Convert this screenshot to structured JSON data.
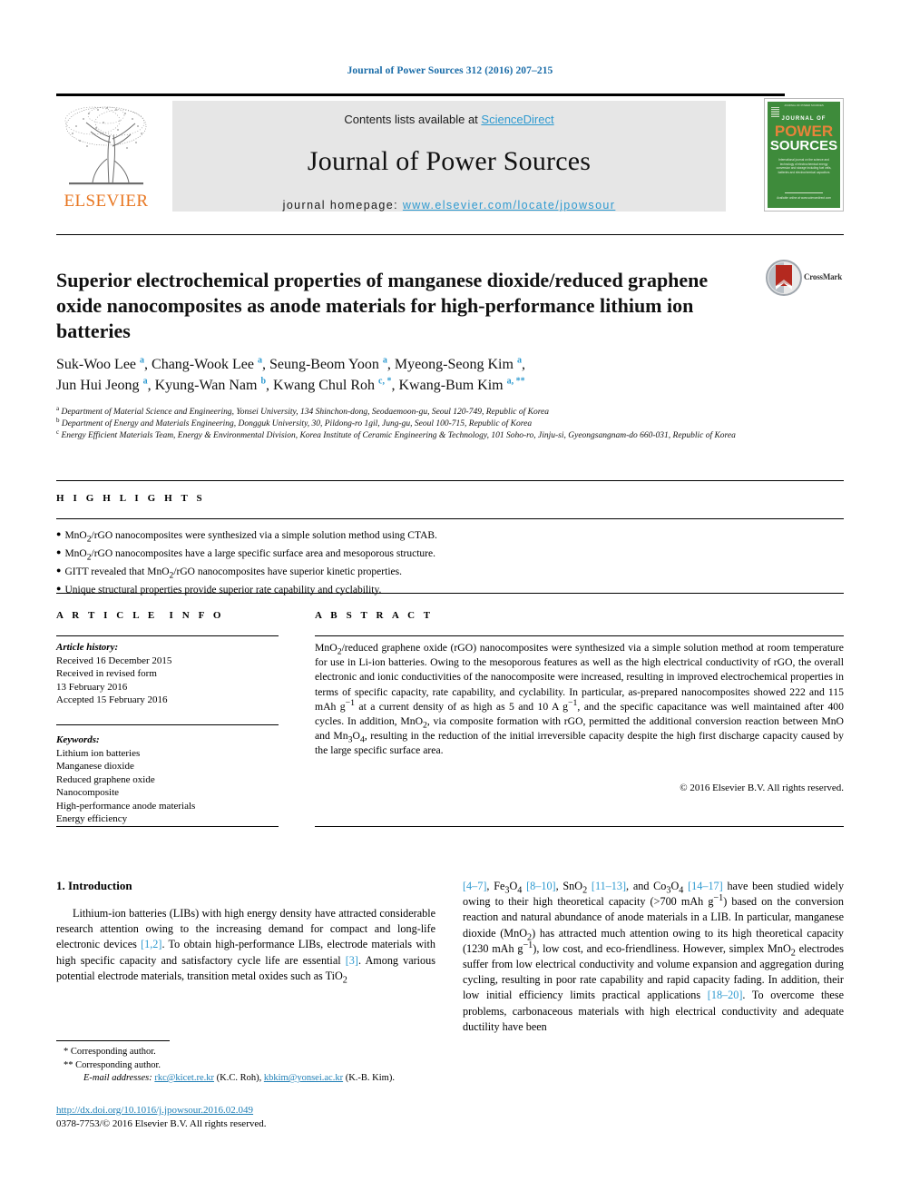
{
  "running_head": "Journal of Power Sources 312 (2016) 207–215",
  "masthead": {
    "contents_prefix": "Contents lists available at ",
    "sciencedirect": "ScienceDirect",
    "journal_name": "Journal of Power Sources",
    "homepage_label": "journal homepage:",
    "homepage_url": "www.elsevier.com/locate/jpowsour",
    "publisher": "ELSEVIER",
    "publisher_logo_icon": "elsevier-tree-icon"
  },
  "cover": {
    "top_bar": "JOURNAL OF POWER SOURCES",
    "journal_of": "JOURNAL OF",
    "power": "POWER",
    "sources": "SOURCES",
    "blurb": "International journal on the science and technology of electrochemical energy conversion and storage including fuel cells, batteries and electrochemical capacitors",
    "bottom": "Available online at www.sciencedirect.com"
  },
  "crossmark": {
    "label": "CrossMark",
    "icon": "crossmark-icon"
  },
  "title": "Superior electrochemical properties of manganese dioxide/reduced graphene oxide nanocomposites as anode materials for high-performance lithium ion batteries",
  "authors": [
    {
      "name": "Suk-Woo Lee",
      "marks": "a",
      "sep": ", "
    },
    {
      "name": "Chang-Wook Lee",
      "marks": "a",
      "sep": ", "
    },
    {
      "name": "Seung-Beom Yoon",
      "marks": "a",
      "sep": ", "
    },
    {
      "name": "Myeong-Seong Kim",
      "marks": "a",
      "sep": ", "
    },
    {
      "name": "Jun Hui Jeong",
      "marks": "a",
      "sep": ", "
    },
    {
      "name": "Kyung-Wan Nam",
      "marks": "b",
      "sep": ", "
    },
    {
      "name": "Kwang Chul Roh",
      "marks": "c, *",
      "sep": ", "
    },
    {
      "name": "Kwang-Bum Kim",
      "marks": "a, **",
      "sep": ""
    }
  ],
  "affiliations": [
    {
      "mark": "a",
      "text": "Department of Material Science and Engineering, Yonsei University, 134 Shinchon-dong, Seodaemoon-gu, Seoul 120-749, Republic of Korea"
    },
    {
      "mark": "b",
      "text": "Department of Energy and Materials Engineering, Dongguk University, 30, Pildong-ro 1gil, Jung-gu, Seoul 100-715, Republic of Korea"
    },
    {
      "mark": "c",
      "text": "Energy Efficient Materials Team, Energy & Environmental Division, Korea Institute of Ceramic Engineering & Technology, 101 Soho-ro, Jinju-si, Gyeongsangnam-do 660-031, Republic of Korea"
    }
  ],
  "highlights": {
    "heading": "HIGHLIGHTS",
    "items": [
      "MnO2/rGO nanocomposites were synthesized via a simple solution method using CTAB.",
      "MnO2/rGO nanocomposites have a large specific surface area and mesoporous structure.",
      "GITT revealed that MnO2/rGO nanocomposites have superior kinetic properties.",
      "Unique structural properties provide superior rate capability and cyclability."
    ]
  },
  "article_info": {
    "heading": "ARTICLE INFO",
    "history_label": "Article history:",
    "history": [
      "Received 16 December 2015",
      "Received in revised form",
      "13 February 2016",
      "Accepted 15 February 2016"
    ],
    "keywords_label": "Keywords:",
    "keywords": [
      "Lithium ion batteries",
      "Manganese dioxide",
      "Reduced graphene oxide",
      "Nanocomposite",
      "High-performance anode materials",
      "Energy efficiency"
    ]
  },
  "abstract": {
    "heading": "ABSTRACT",
    "text": "MnO2/reduced graphene oxide (rGO) nanocomposites were synthesized via a simple solution method at room temperature for use in Li-ion batteries. Owing to the mesoporous features as well as the high electrical conductivity of rGO, the overall electronic and ionic conductivities of the nanocomposite were increased, resulting in improved electrochemical properties in terms of specific capacity, rate capability, and cyclability. In particular, as-prepared nanocomposites showed 222 and 115 mAh g−1 at a current density of as high as 5 and 10 A g−1, and the specific capacitance was well maintained after 400 cycles. In addition, MnO2, via composite formation with rGO, permitted the additional conversion reaction between MnO and Mn3O4, resulting in the reduction of the initial irreversible capacity despite the high first discharge capacity caused by the large specific surface area.",
    "copyright": "© 2016 Elsevier B.V. All rights reserved."
  },
  "introduction": {
    "heading": "1. Introduction",
    "left_paragraph": "Lithium-ion batteries (LIBs) with high energy density have attracted considerable research attention owing to the increasing demand for compact and long-life electronic devices [1,2]. To obtain high-performance LIBs, electrode materials with high specific capacity and satisfactory cycle life are essential [3]. Among various potential electrode materials, transition metal oxides such as TiO2",
    "right_paragraph": "[4–7], Fe3O4 [8–10], SnO2 [11–13], and Co3O4 [14–17] have been studied widely owing to their high theoretical capacity (>700 mAh g−1) based on the conversion reaction and natural abundance of anode materials in a LIB. In particular, manganese dioxide (MnO2) has attracted much attention owing to its high theoretical capacity (1230 mAh g−1), low cost, and eco-friendliness. However, simplex MnO2 electrodes suffer from low electrical conductivity and volume expansion and aggregation during cycling, resulting in poor rate capability and rapid capacity fading. In addition, their low initial efficiency limits practical applications [18–20]. To overcome these problems, carbonaceous materials with high electrical conductivity and adequate ductility have been"
  },
  "footnotes": {
    "corresponding1": "* Corresponding author.",
    "corresponding2": "** Corresponding author.",
    "email_label": "E-mail addresses:",
    "email1": "rkc@kicet.re.kr",
    "email1_name": "(K.C. Roh),",
    "email2": "kbkim@yonsei.ac.kr",
    "email2_name": "(K.-B. Kim)."
  },
  "footer": {
    "doi": "http://dx.doi.org/10.1016/j.jpowsour.2016.02.049",
    "issn": "0378-7753/© 2016 Elsevier B.V. All rights reserved."
  },
  "colors": {
    "link_blue": "#2e9ad0",
    "head_blue": "#1a6ca8",
    "elsevier_orange": "#e87722",
    "cover_green": "#3e8b3b",
    "crossmark_red": "#b4291f"
  }
}
